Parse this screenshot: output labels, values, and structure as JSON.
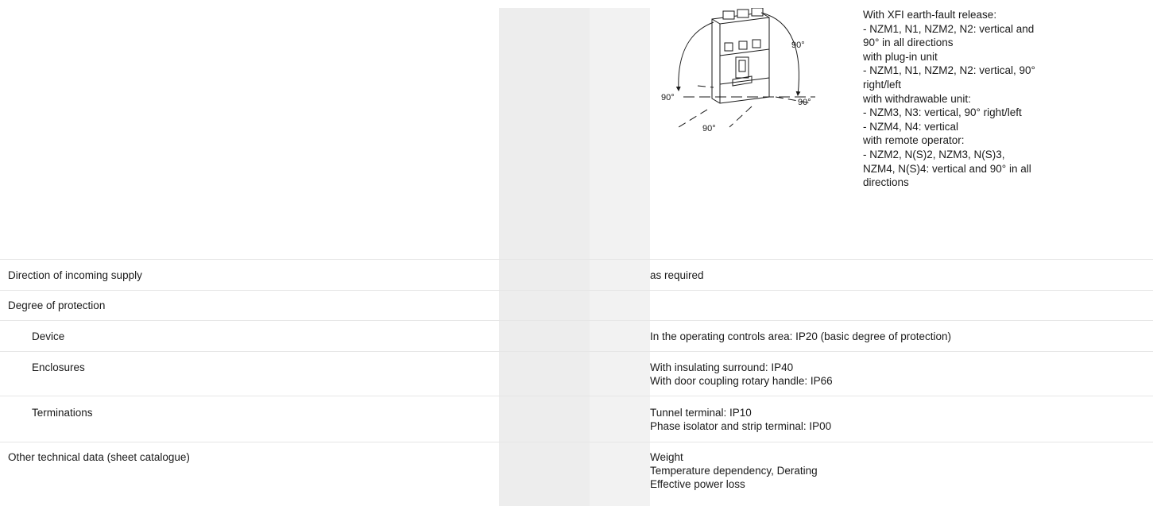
{
  "mounting": {
    "figure_labels": {
      "top_right": "90°",
      "left": "90°",
      "bottom_right": "90°",
      "bottom": "90°"
    },
    "notes": [
      "With XFI earth-fault release:",
      "- NZM1, N1, NZM2, N2: vertical and",
      "90° in all directions",
      "with plug-in unit",
      "- NZM1, N1, NZM2, N2: vertical, 90°",
      "right/left",
      "with withdrawable unit:",
      "- NZM3, N3: vertical, 90° right/left",
      "- NZM4, N4: vertical",
      "with remote operator:",
      "- NZM2, N(S)2, NZM3, N(S)3,",
      "NZM4, N(S)4: vertical and 90° in all",
      "directions"
    ]
  },
  "rows": [
    {
      "label": "Direction of incoming supply",
      "values": [
        "as required"
      ]
    },
    {
      "label": "Degree of protection",
      "values": []
    },
    {
      "label": "Device",
      "values": [
        "In the operating controls area: IP20 (basic degree of protection)"
      ]
    },
    {
      "label": "Enclosures",
      "values": [
        "With insulating surround: IP40",
        "With door coupling rotary handle: IP66"
      ]
    },
    {
      "label": "Terminations",
      "values": [
        "Tunnel terminal: IP10",
        "Phase isolator and strip terminal: IP00"
      ]
    },
    {
      "label": "Other technical data (sheet catalogue)",
      "values": [
        "Weight",
        "Temperature dependency, Derating",
        "Effective power loss"
      ]
    }
  ]
}
